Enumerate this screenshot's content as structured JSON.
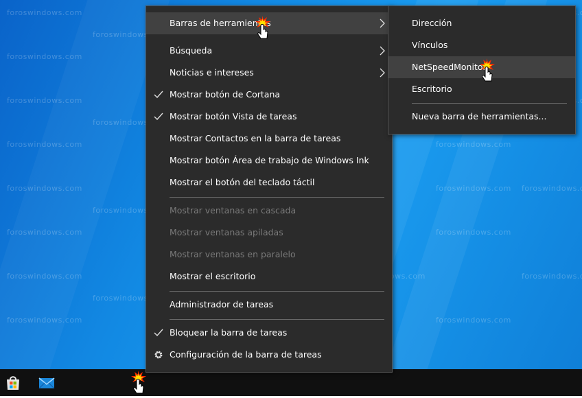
{
  "watermark_text": "foroswindows.com",
  "main_menu": {
    "toolbars": "Barras de herramientas",
    "search": "Búsqueda",
    "news": "Noticias e intereses",
    "cortana": "Mostrar botón de Cortana",
    "task_view": "Mostrar botón Vista de tareas",
    "contacts": "Mostrar Contactos en la barra de tareas",
    "ink": "Mostrar botón Área de trabajo de Windows Ink",
    "keyboard": "Mostrar el botón del teclado táctil",
    "cascade": "Mostrar ventanas en cascada",
    "stacked": "Mostrar ventanas apiladas",
    "side_by_side": "Mostrar ventanas en paralelo",
    "show_desktop": "Mostrar el escritorio",
    "task_manager": "Administrador de tareas",
    "lock": "Bloquear la barra de tareas",
    "settings": "Configuración de la barra de tareas"
  },
  "sub_menu": {
    "address": "Dirección",
    "links": "Vínculos",
    "netspeed": "NetSpeedMonitor",
    "desktop": "Escritorio",
    "new_toolbar": "Nueva barra de herramientas..."
  },
  "colors": {
    "menu_bg": "#2b2b2b",
    "hover_bg": "#414141",
    "disabled_text": "#7a7a7a",
    "taskbar": "#101010"
  },
  "icons": {
    "store": "store-icon",
    "mail": "mail-icon",
    "check": "check-icon",
    "gear": "gear-icon",
    "submenu_arrow": "chevron-right-icon",
    "cursor": "hand-cursor-icon"
  }
}
